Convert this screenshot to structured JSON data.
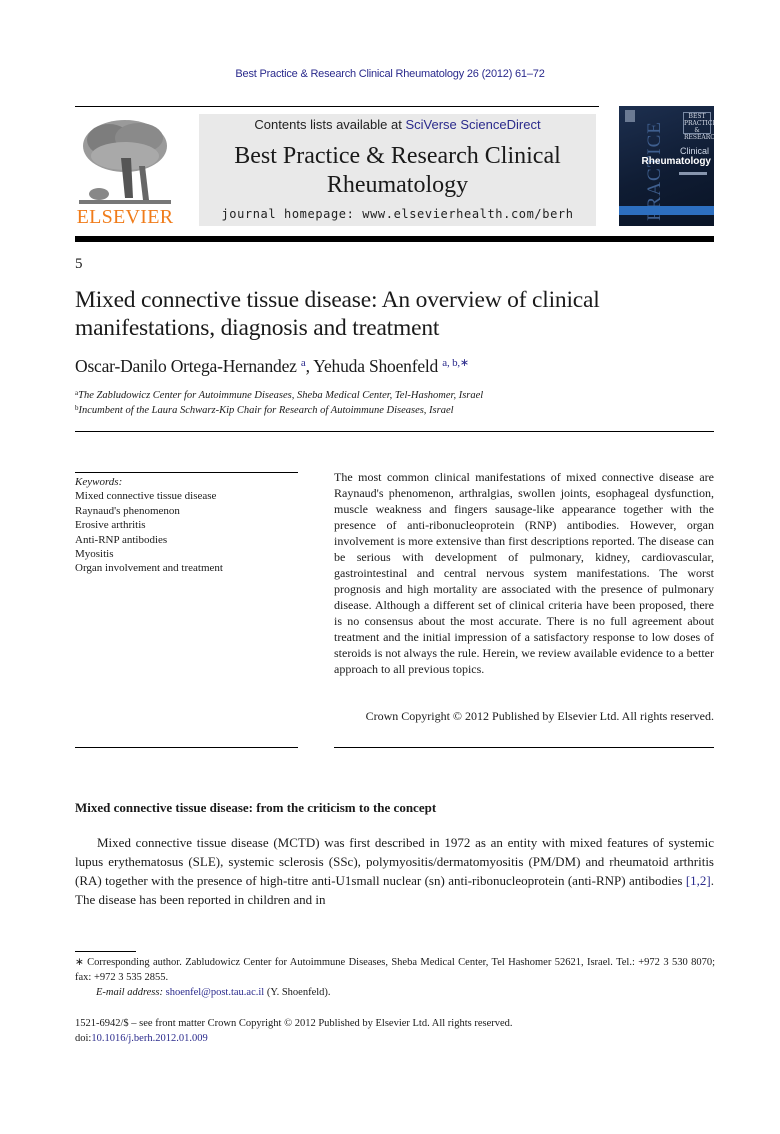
{
  "running_head": "Best Practice & Research Clinical Rheumatology 26 (2012) 61–72",
  "publisher": {
    "logo_word": "ELSEVIER",
    "brand_color": "#f07c1a"
  },
  "masthead": {
    "contents_prefix": "Contents lists available at ",
    "contents_link": "SciVerse ScienceDirect",
    "journal_title_line1": "Best Practice & Research Clinical",
    "journal_title_line2": "Rheumatology",
    "homepage": "journal homepage: www.elsevierhealth.com/berh"
  },
  "cover": {
    "badge": "BEST PRACTICE & RESEARCH",
    "clinical": "Clinical",
    "rheumatology": "Rheumatology",
    "side_word": "PRACTICE"
  },
  "article": {
    "chapter_number": "5",
    "title": "Mixed connective tissue disease: An overview of clinical manifestations, diagnosis and treatment",
    "authors": [
      {
        "name": "Oscar-Danilo Ortega-Hernandez",
        "marks": "a"
      },
      {
        "name": "Yehuda Shoenfeld",
        "marks": "a, b,∗"
      }
    ],
    "affiliations": [
      {
        "mark": "a",
        "text": "The Zabludowicz Center for Autoimmune Diseases, Sheba Medical Center, Tel-Hashomer, Israel"
      },
      {
        "mark": "b",
        "text": "Incumbent of the Laura Schwarz-Kip Chair for Research of Autoimmune Diseases, Israel"
      }
    ]
  },
  "keywords": {
    "label": "Keywords:",
    "items": [
      "Mixed connective tissue disease",
      "Raynaud's phenomenon",
      "Erosive arthritis",
      "Anti-RNP antibodies",
      "Myositis",
      "Organ involvement and treatment"
    ]
  },
  "abstract": {
    "text": "The most common clinical manifestations of mixed connective disease are Raynaud's phenomenon, arthralgias, swollen joints, esophageal dysfunction, muscle weakness and fingers sausage-like appearance together with the presence of anti-ribonucleoprotein (RNP) antibodies. However, organ involvement is more extensive than first descriptions reported. The disease can be serious with development of pulmonary, kidney, cardiovascular, gastrointestinal and central nervous system manifestations. The worst prognosis and high mortality are associated with the presence of pulmonary disease. Although a different set of clinical criteria have been proposed, there is no consensus about the most accurate. There is no full agreement about treatment and the initial impression of a satisfactory response to low doses of steroids is not always the rule. Herein, we review available evidence to a better approach to all previous topics.",
    "copyright": "Crown Copyright © 2012 Published by Elsevier Ltd. All rights reserved."
  },
  "section": {
    "heading": "Mixed connective tissue disease: from the criticism to the concept",
    "para_before_ref": "Mixed connective tissue disease (MCTD) was first described in 1972 as an entity with mixed features of systemic lupus erythematosus (SLE), systemic sclerosis (SSc), polymyositis/dermatomyositis (PM/DM) and rheumatoid arthritis (RA) together with the presence of high-titre anti-U1small nuclear (sn) anti-ribonucleoprotein (anti-RNP) antibodies ",
    "ref": "[1,2]",
    "para_after_ref": ". The disease has been reported in children and in"
  },
  "footnotes": {
    "corresponding": "∗ Corresponding author. Zabludowicz Center for Autoimmune Diseases, Sheba Medical Center, Tel Hashomer 52621, Israel. Tel.: +972 3 530 8070; fax: +972 3 535 2855.",
    "email_label": "E-mail address:",
    "email": "shoenfel@post.tau.ac.il",
    "email_suffix": " (Y. Shoenfeld).",
    "issn_line": "1521-6942/$ – see front matter Crown Copyright © 2012 Published by Elsevier Ltd. All rights reserved.",
    "doi_prefix": "doi:",
    "doi": "10.1016/j.berh.2012.01.009"
  }
}
